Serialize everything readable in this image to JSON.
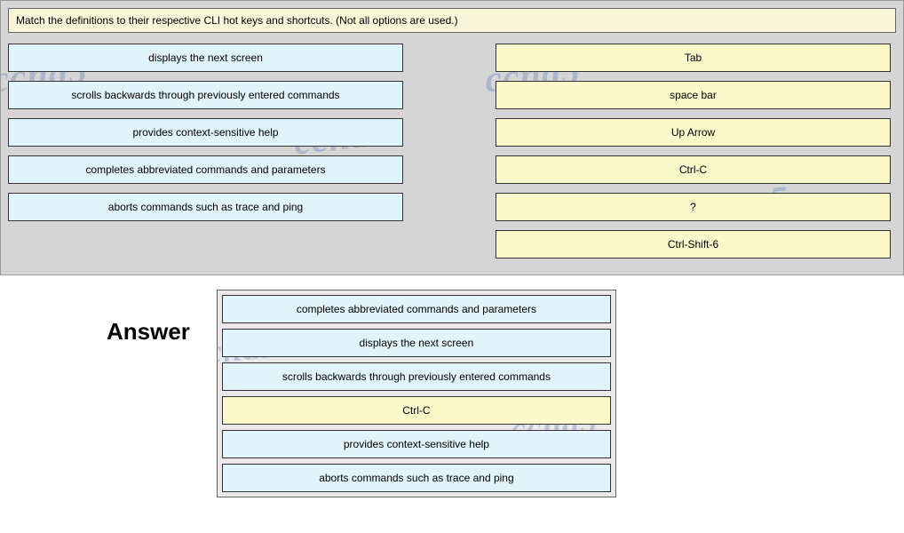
{
  "question": "Match the definitions to their respective CLI hot keys and shortcuts. (Not all options are used.)",
  "left_items": [
    "displays the next screen",
    "scrolls backwards through previously entered commands",
    "provides context-sensitive help",
    "completes abbreviated commands and parameters",
    "aborts commands such as trace and ping"
  ],
  "right_items": [
    "Tab",
    "space bar",
    "Up Arrow",
    "Ctrl-C",
    "?",
    "Ctrl-Shift-6"
  ],
  "answer_label": "Answer",
  "answer_items": [
    {
      "text": "completes abbreviated commands and parameters",
      "type": "blue"
    },
    {
      "text": "displays the next screen",
      "type": "blue"
    },
    {
      "text": "scrolls backwards through previously entered commands",
      "type": "blue"
    },
    {
      "text": "Ctrl-C",
      "type": "yellow"
    },
    {
      "text": "provides context-sensitive help",
      "type": "blue"
    },
    {
      "text": "aborts commands such as trace and ping",
      "type": "blue"
    }
  ],
  "watermark_text": "ccna5"
}
